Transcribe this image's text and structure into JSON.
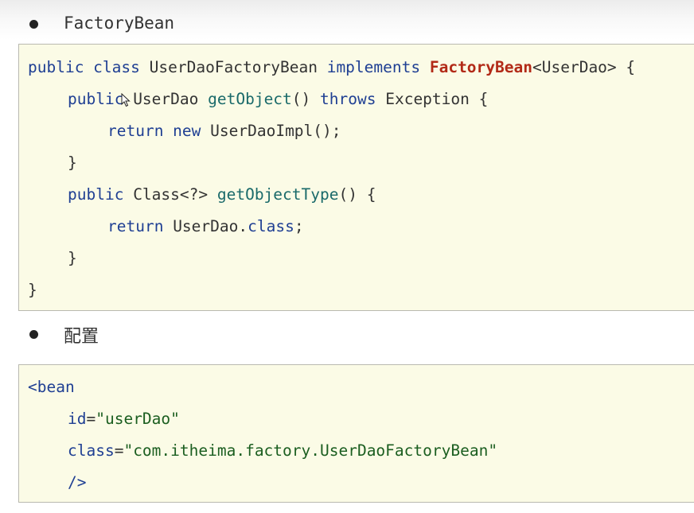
{
  "bullets": {
    "first": "FactoryBean",
    "second": "配置"
  },
  "java_code": {
    "l1": {
      "kw1": "public class",
      "name": " UserDaoFactoryBean ",
      "kw2": "implements",
      "iface": " FactoryBean",
      "rest": "<UserDao> {"
    },
    "l2": {
      "kw1": "public",
      "type": " UserDao ",
      "method": "getObject",
      "paren": "() ",
      "kw2": "throws",
      "rest": " Exception {"
    },
    "l3": {
      "kw1": "return new",
      "rest": " UserDaoImpl();"
    },
    "l4": {
      "brace": "}"
    },
    "l5": {
      "kw1": "public",
      "type": " Class<?> ",
      "method": "getObjectType",
      "rest": "() {"
    },
    "l6": {
      "kw1": "return",
      "type": " UserDao.",
      "kw2": "class",
      "rest": ";"
    },
    "l7": {
      "brace": "}"
    },
    "l8": {
      "brace": "}"
    }
  },
  "xml_code": {
    "l1": {
      "tag": "<bean"
    },
    "l2": {
      "attr": "id",
      "eq": "=",
      "val": "\"userDao\""
    },
    "l3": {
      "attr": "class",
      "eq": "=",
      "val": "\"com.itheima.factory.UserDaoFactoryBean\""
    },
    "l4": {
      "close": "/>"
    }
  },
  "colors": {
    "keyword": "#1f3f93",
    "interface": "#b22a17",
    "method": "#1a6a6a",
    "string": "#1b5e20",
    "code_background": "#fbfbe6"
  },
  "icons": {
    "cursor": "mouse-pointer-icon"
  }
}
